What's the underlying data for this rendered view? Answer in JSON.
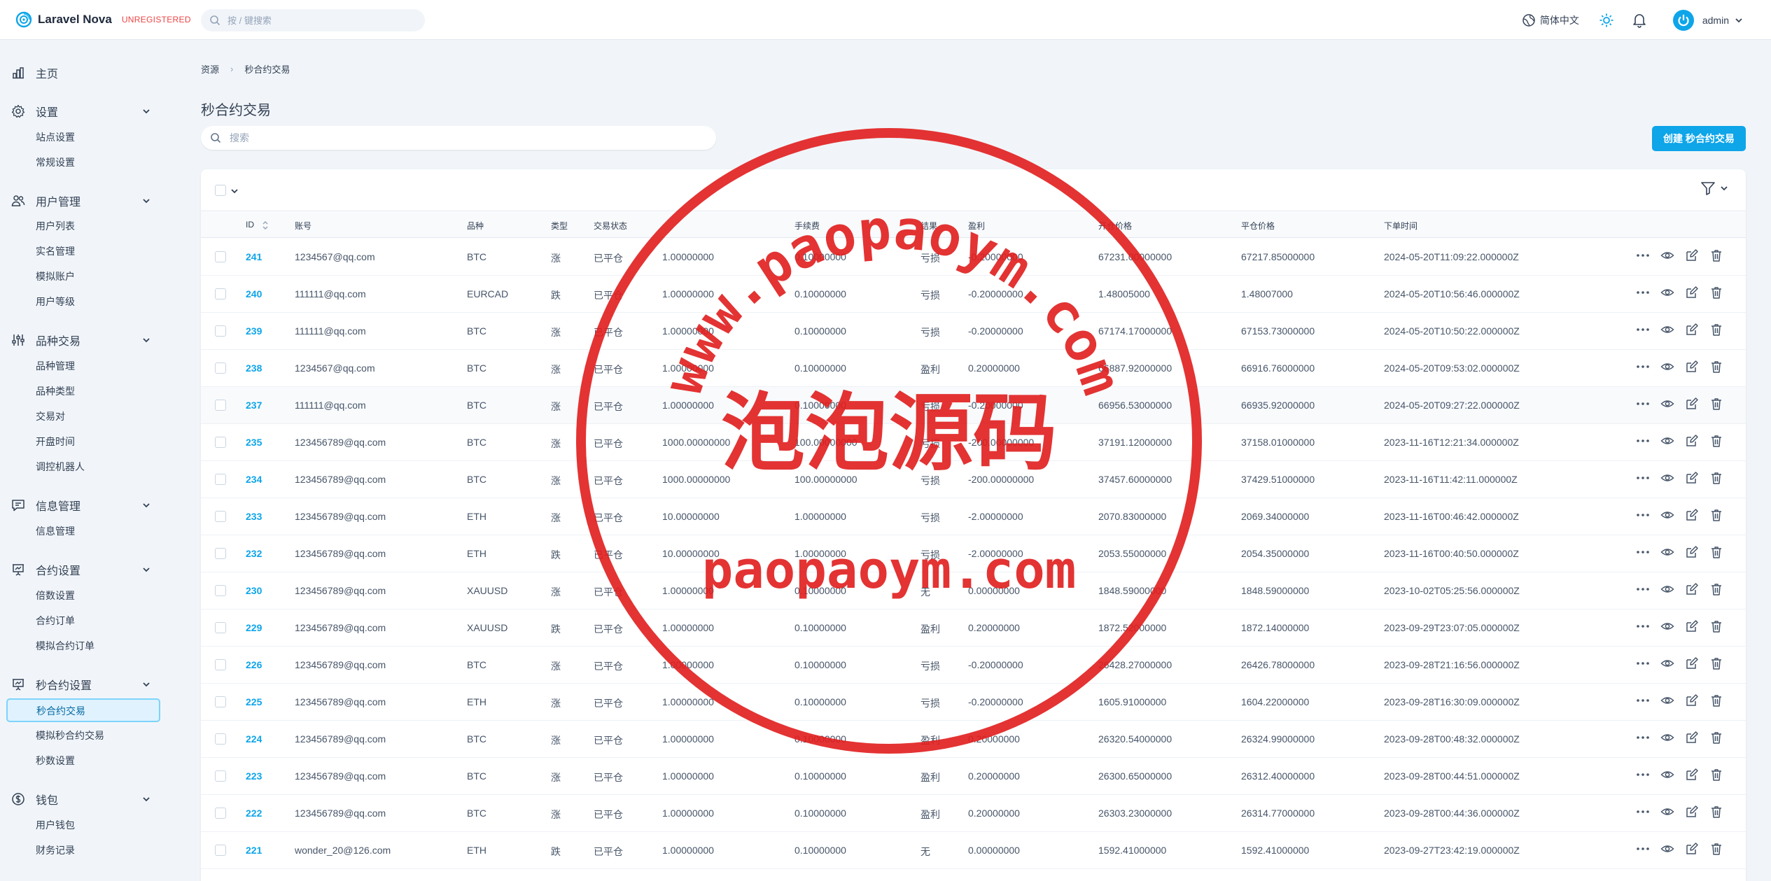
{
  "app": {
    "name": "Laravel Nova",
    "badge": "UNREGISTERED",
    "search_placeholder": "按 / 键搜索",
    "language": "简体中文",
    "user": "admin",
    "accent": "#0ea5e9"
  },
  "sidebar": {
    "sections": [
      {
        "label": "主页",
        "icon": "chart-bar-icon",
        "items": []
      },
      {
        "label": "设置",
        "icon": "gear-icon",
        "items": [
          "站点设置",
          "常规设置"
        ]
      },
      {
        "label": "用户管理",
        "icon": "users-icon",
        "items": [
          "用户列表",
          "实名管理",
          "模拟账户",
          "用户等级"
        ]
      },
      {
        "label": "品种交易",
        "icon": "sliders-icon",
        "items": [
          "品种管理",
          "品种类型",
          "交易对",
          "开盘时间",
          "调控机器人"
        ]
      },
      {
        "label": "信息管理",
        "icon": "chat-icon",
        "items": [
          "信息管理"
        ]
      },
      {
        "label": "合约设置",
        "icon": "presentation-icon",
        "items": [
          "倍数设置",
          "合约订单",
          "模拟合约订单"
        ]
      },
      {
        "label": "秒合约设置",
        "icon": "presentation-chart-icon",
        "items": [
          "秒合约交易",
          "模拟秒合约交易",
          "秒数设置"
        ],
        "active": "秒合约交易"
      },
      {
        "label": "钱包",
        "icon": "currency-icon",
        "items": [
          "用户钱包",
          "财务记录"
        ]
      }
    ]
  },
  "breadcrumb": [
    "资源",
    "秒合约交易"
  ],
  "page_title": "秒合约交易",
  "resource_search_placeholder": "搜索",
  "create_button": "创建 秒合约交易",
  "table": {
    "columns": [
      "ID",
      "账号",
      "品种",
      "类型",
      "交易状态",
      "",
      "手续费",
      "结果",
      "盈利",
      "开仓价格",
      "平仓价格",
      "下单时间"
    ],
    "rows": [
      [
        "241",
        "1234567@qq.com",
        "BTC",
        "涨",
        "已平仓",
        "1.00000000",
        "0.10000000",
        "亏损",
        "-0.20000000",
        "67231.00000000",
        "67217.85000000",
        "2024-05-20T11:09:22.000000Z"
      ],
      [
        "240",
        "111111@qq.com",
        "EURCAD",
        "跌",
        "已平仓",
        "1.00000000",
        "0.10000000",
        "亏损",
        "-0.20000000",
        "1.48005000",
        "1.48007000",
        "2024-05-20T10:56:46.000000Z"
      ],
      [
        "239",
        "111111@qq.com",
        "BTC",
        "涨",
        "已平仓",
        "1.00000000",
        "0.10000000",
        "亏损",
        "-0.20000000",
        "67174.17000000",
        "67153.73000000",
        "2024-05-20T10:50:22.000000Z"
      ],
      [
        "238",
        "1234567@qq.com",
        "BTC",
        "涨",
        "已平仓",
        "1.00000000",
        "0.10000000",
        "盈利",
        "0.20000000",
        "66887.92000000",
        "66916.76000000",
        "2024-05-20T09:53:02.000000Z"
      ],
      [
        "237",
        "111111@qq.com",
        "BTC",
        "涨",
        "已平仓",
        "1.00000000",
        "0.10000000",
        "亏损",
        "-0.20000000",
        "66956.53000000",
        "66935.92000000",
        "2024-05-20T09:27:22.000000Z"
      ],
      [
        "235",
        "123456789@qq.com",
        "BTC",
        "涨",
        "已平仓",
        "1000.00000000",
        "100.00000000",
        "亏损",
        "-200.00000000",
        "37191.12000000",
        "37158.01000000",
        "2023-11-16T12:21:34.000000Z"
      ],
      [
        "234",
        "123456789@qq.com",
        "BTC",
        "涨",
        "已平仓",
        "1000.00000000",
        "100.00000000",
        "亏损",
        "-200.00000000",
        "37457.60000000",
        "37429.51000000",
        "2023-11-16T11:42:11.000000Z"
      ],
      [
        "233",
        "123456789@qq.com",
        "ETH",
        "涨",
        "已平仓",
        "10.00000000",
        "1.00000000",
        "亏损",
        "-2.00000000",
        "2070.83000000",
        "2069.34000000",
        "2023-11-16T00:46:42.000000Z"
      ],
      [
        "232",
        "123456789@qq.com",
        "ETH",
        "跌",
        "已平仓",
        "10.00000000",
        "1.00000000",
        "亏损",
        "-2.00000000",
        "2053.55000000",
        "2054.35000000",
        "2023-11-16T00:40:50.000000Z"
      ],
      [
        "230",
        "123456789@qq.com",
        "XAUUSD",
        "涨",
        "已平仓",
        "1.00000000",
        "0.10000000",
        "无",
        "0.00000000",
        "1848.59000000",
        "1848.59000000",
        "2023-10-02T05:25:56.000000Z"
      ],
      [
        "229",
        "123456789@qq.com",
        "XAUUSD",
        "跌",
        "已平仓",
        "1.00000000",
        "0.10000000",
        "盈利",
        "0.20000000",
        "1872.52000000",
        "1872.14000000",
        "2023-09-29T23:07:05.000000Z"
      ],
      [
        "226",
        "123456789@qq.com",
        "BTC",
        "涨",
        "已平仓",
        "1.00000000",
        "0.10000000",
        "亏损",
        "-0.20000000",
        "26428.27000000",
        "26426.78000000",
        "2023-09-28T21:16:56.000000Z"
      ],
      [
        "225",
        "123456789@qq.com",
        "ETH",
        "涨",
        "已平仓",
        "1.00000000",
        "0.10000000",
        "亏损",
        "-0.20000000",
        "1605.91000000",
        "1604.22000000",
        "2023-09-28T16:30:09.000000Z"
      ],
      [
        "224",
        "123456789@qq.com",
        "BTC",
        "涨",
        "已平仓",
        "1.00000000",
        "0.10000000",
        "盈利",
        "0.20000000",
        "26320.54000000",
        "26324.99000000",
        "2023-09-28T00:48:32.000000Z"
      ],
      [
        "223",
        "123456789@qq.com",
        "BTC",
        "涨",
        "已平仓",
        "1.00000000",
        "0.10000000",
        "盈利",
        "0.20000000",
        "26300.65000000",
        "26312.40000000",
        "2023-09-28T00:44:51.000000Z"
      ],
      [
        "222",
        "123456789@qq.com",
        "BTC",
        "涨",
        "已平仓",
        "1.00000000",
        "0.10000000",
        "盈利",
        "0.20000000",
        "26303.23000000",
        "26314.77000000",
        "2023-09-28T00:44:36.000000Z"
      ],
      [
        "221",
        "wonder_20@126.com",
        "ETH",
        "跌",
        "已平仓",
        "1.00000000",
        "0.10000000",
        "无",
        "0.00000000",
        "1592.41000000",
        "1592.41000000",
        "2023-09-27T23:42:19.000000Z"
      ]
    ],
    "highlighted_row": "237"
  },
  "watermark": {
    "arc_text": "www.paopaoym.com",
    "center_text": "泡泡源码",
    "bottom_text": "paopaoym.com",
    "color": "#e11d1d"
  }
}
